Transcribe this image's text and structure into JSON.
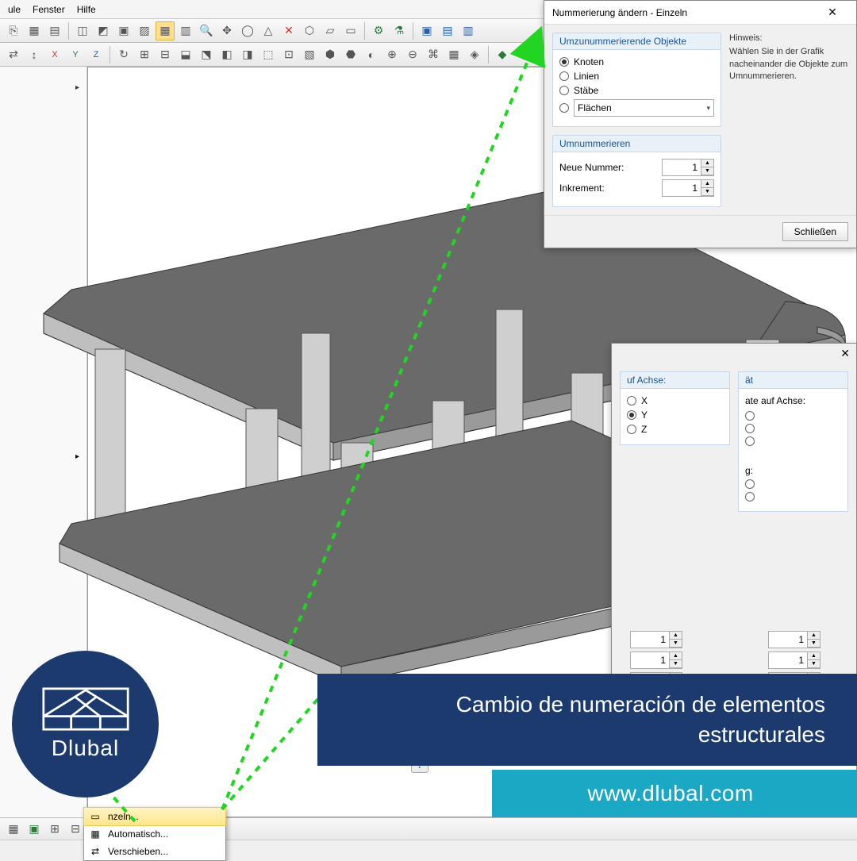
{
  "menubar": {
    "items": [
      "ule",
      "Fenster",
      "Hilfe"
    ]
  },
  "dialog1": {
    "title": "Nummerierung ändern - Einzeln",
    "group_objects": {
      "title": "Umzunummerierende Objekte",
      "options": [
        "Knoten",
        "Linien",
        "Stäbe"
      ],
      "combo": "Flächen"
    },
    "group_renumber": {
      "title": "Umnummerieren",
      "new_label": "Neue Nummer:",
      "new_value": "1",
      "inc_label": "Inkrement:",
      "inc_value": "1"
    },
    "hint_title": "Hinweis:",
    "hint_text": "Wählen Sie in der Grafik nacheinander die Objekte zum Umnummerieren.",
    "close": "Schließen"
  },
  "dialog2": {
    "col2_title": "uf Achse:",
    "col3_partial": "ät",
    "col3_title": "ate auf Achse:",
    "axis": [
      "X",
      "Y",
      "Z"
    ],
    "axis_selected": "Y",
    "direction_partial": "g:",
    "spin_value": "1"
  },
  "ctxmenu": {
    "items": [
      "nzeln...",
      "Automatisch...",
      "Verschieben..."
    ]
  },
  "promo": {
    "brand": "Dlubal",
    "title": "Cambio de numeración de elementos estructurales",
    "url": "www.dlubal.com"
  },
  "bottombar_help": "?"
}
